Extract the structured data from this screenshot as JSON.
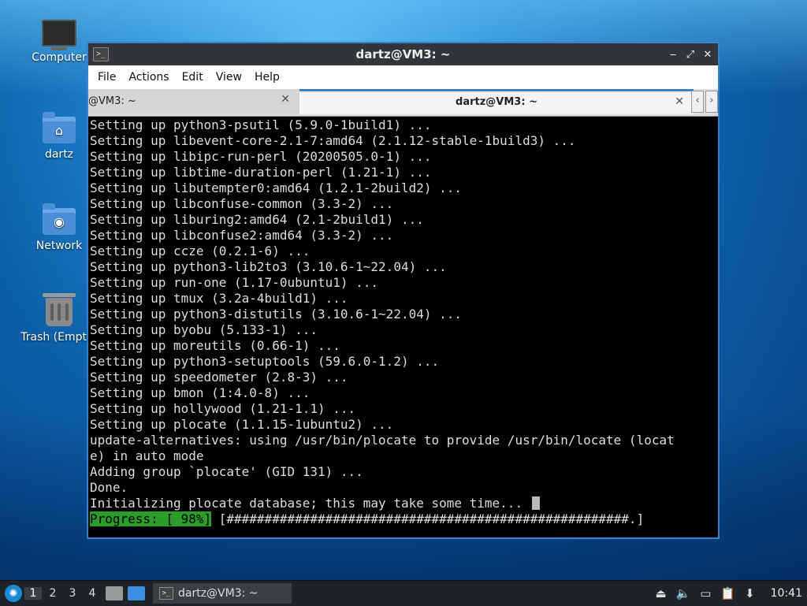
{
  "desktop": {
    "icons": [
      {
        "label": "Computer",
        "icon": "computer-icon"
      },
      {
        "label": "dartz",
        "icon": "home-folder-icon"
      },
      {
        "label": "Network",
        "icon": "network-folder-icon"
      },
      {
        "label": "Trash (Empty)",
        "icon": "trash-icon"
      }
    ]
  },
  "window": {
    "title": "dartz@VM3: ~",
    "controls": [
      "minimize",
      "maximize",
      "close"
    ],
    "menu": [
      "File",
      "Actions",
      "Edit",
      "View",
      "Help"
    ],
    "tabs": [
      {
        "label": "@VM3: ~",
        "active": false
      },
      {
        "label": "dartz@VM3: ~",
        "active": true
      }
    ]
  },
  "terminal": {
    "lines": [
      "Setting up python3-psutil (5.9.0-1build1) ...",
      "Setting up libevent-core-2.1-7:amd64 (2.1.12-stable-1build3) ...",
      "Setting up libipc-run-perl (20200505.0-1) ...",
      "Setting up libtime-duration-perl (1.21-1) ...",
      "Setting up libutempter0:amd64 (1.2.1-2build2) ...",
      "Setting up libconfuse-common (3.3-2) ...",
      "Setting up liburing2:amd64 (2.1-2build1) ...",
      "Setting up libconfuse2:amd64 (3.3-2) ...",
      "Setting up ccze (0.2.1-6) ...",
      "Setting up python3-lib2to3 (3.10.6-1~22.04) ...",
      "Setting up run-one (1.17-0ubuntu1) ...",
      "Setting up tmux (3.2a-4build1) ...",
      "Setting up python3-distutils (3.10.6-1~22.04) ...",
      "Setting up byobu (5.133-1) ...",
      "Setting up moreutils (0.66-1) ...",
      "Setting up python3-setuptools (59.6.0-1.2) ...",
      "Setting up speedometer (2.8-3) ...",
      "Setting up bmon (1:4.0-8) ...",
      "Setting up hollywood (1.21-1.1) ...",
      "Setting up plocate (1.1.15-1ubuntu2) ...",
      "update-alternatives: using /usr/bin/plocate to provide /usr/bin/locate (locat",
      "e) in auto mode",
      "Adding group `plocate' (GID 131) ...",
      "Done.",
      "Initializing plocate database; this may take some time... "
    ],
    "progress_label": "Progress: [ 98%]",
    "progress_bar": " [#####################################################.]",
    "progress_percent": 98
  },
  "taskbar": {
    "workspaces": [
      "1",
      "2",
      "3",
      "4"
    ],
    "active_workspace": "1",
    "task_label": "dartz@VM3: ~",
    "clock": "10:41"
  },
  "colors": {
    "accent": "#3a7fd0",
    "progress_green": "#2a9d2a"
  }
}
